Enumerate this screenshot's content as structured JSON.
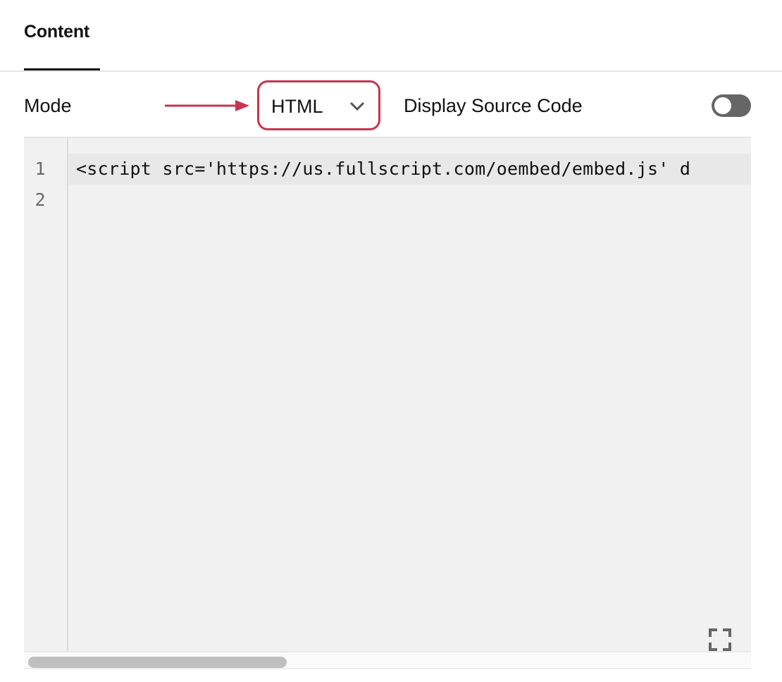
{
  "tabs": [
    {
      "label": "Content",
      "active": true
    }
  ],
  "settings": {
    "mode_label": "Mode",
    "mode_select": {
      "value": "HTML",
      "options_visible": [
        "HTML"
      ]
    },
    "display_source_label": "Display Source Code",
    "display_source_enabled": false
  },
  "annotation": {
    "highlight_color": "#c8344f",
    "arrow_target": "mode-select"
  },
  "editor": {
    "lines": [
      {
        "number": "1",
        "text": "<script src='https://us.fullscript.com/oembed/embed.js' d",
        "active": true
      },
      {
        "number": "2",
        "text": "",
        "active": false
      }
    ],
    "fullscreen_icon": "fullscreen-icon",
    "horizontal_scroll_fraction": 0.36
  }
}
